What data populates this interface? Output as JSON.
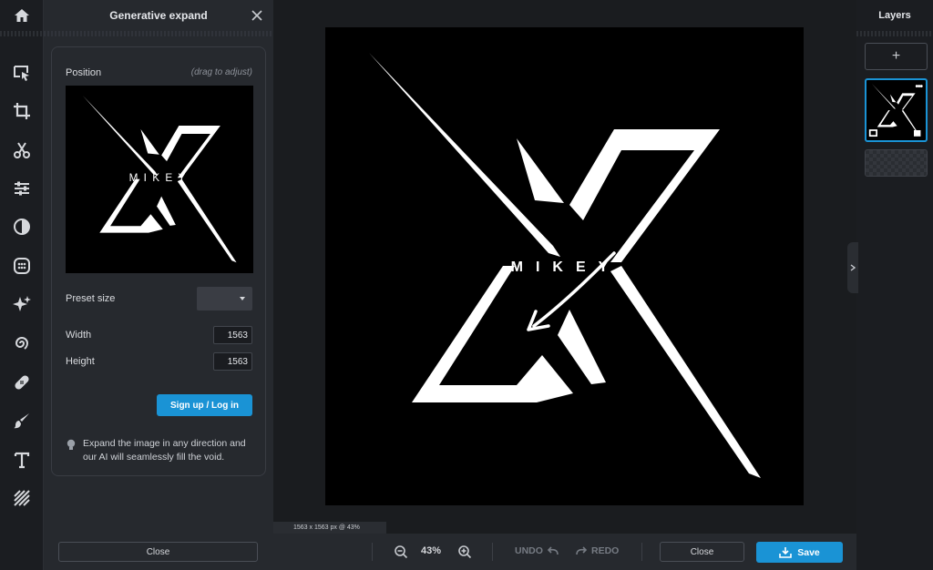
{
  "panel": {
    "title": "Generative expand",
    "position_label": "Position",
    "position_hint": "(drag to adjust)",
    "preset_label": "Preset size",
    "preset_value": "",
    "width_label": "Width",
    "width_value": "1563",
    "height_label": "Height",
    "height_value": "1563",
    "signup_label": "Sign up / Log in",
    "tip_text": "Expand the image in any direction and our AI will seamlessly fill the void.",
    "close_label": "Close"
  },
  "image": {
    "logo_text": "MIKEY",
    "logo_letter": "X"
  },
  "canvas": {
    "info": "1563 x 1563 px @ 43%"
  },
  "bottombar": {
    "zoom_level": "43%",
    "undo_label": "UNDO",
    "redo_label": "REDO",
    "close_label": "Close",
    "save_label": "Save"
  },
  "layers": {
    "title": "Layers",
    "add_label": "+",
    "more_label": "•••"
  },
  "toolbar": {
    "icons": [
      "home-icon",
      "arrange-icon",
      "crop-icon",
      "cut-icon",
      "adjust-icon",
      "filter-icon",
      "effects-icon",
      "ai-sparkle-icon",
      "spiral-icon",
      "retouch-icon",
      "brush-icon",
      "text-icon",
      "texture-icon"
    ]
  },
  "colors": {
    "accent": "#1a93d5",
    "panel_bg": "#26292e",
    "canvas_bg": "#1a1c1f"
  }
}
